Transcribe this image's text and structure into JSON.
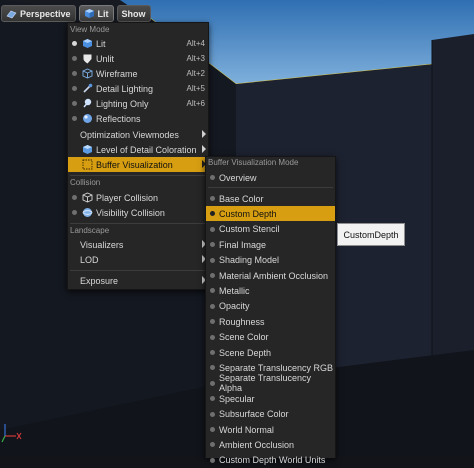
{
  "toolbar": {
    "perspective_label": "Perspective",
    "lit_label": "Lit",
    "show_label": "Show"
  },
  "main_menu": {
    "section_view_mode": "View Mode",
    "items": [
      {
        "label": "Lit",
        "shortcut": "Alt+4",
        "icon": "lit-cube-icon",
        "selected": true
      },
      {
        "label": "Unlit",
        "shortcut": "Alt+3",
        "icon": "unlit-shield-icon",
        "selected": false
      },
      {
        "label": "Wireframe",
        "shortcut": "Alt+2",
        "icon": "wireframe-cube-icon",
        "selected": false
      },
      {
        "label": "Detail Lighting",
        "shortcut": "Alt+5",
        "icon": "detail-lighting-icon",
        "selected": false
      },
      {
        "label": "Lighting Only",
        "shortcut": "Alt+6",
        "icon": "lighting-only-icon",
        "selected": false
      },
      {
        "label": "Reflections",
        "shortcut": "",
        "icon": "reflections-sphere-icon",
        "selected": false
      }
    ],
    "optimization_viewmodes": "Optimization Viewmodes",
    "lod_coloration": "Level of Detail Coloration",
    "buffer_visualization": "Buffer Visualization",
    "section_collision": "Collision",
    "player_collision": "Player Collision",
    "visibility_collision": "Visibility Collision",
    "section_landscape": "Landscape",
    "visualizers": "Visualizers",
    "lod": "LOD",
    "exposure": "Exposure"
  },
  "sub_menu": {
    "header": "Buffer Visualization Mode",
    "overview": "Overview",
    "items": [
      "Base Color",
      "Custom Depth",
      "Custom Stencil",
      "Final Image",
      "Shading Model",
      "Material Ambient Occlusion",
      "Metallic",
      "Opacity",
      "Roughness",
      "Scene Color",
      "Scene Depth",
      "Separate Translucency RGB",
      "Separate Translucency Alpha",
      "Specular",
      "Subsurface Color",
      "World Normal",
      "Ambient Occlusion",
      "Custom Depth World Units"
    ],
    "selected_index": 1
  },
  "tooltip": "CustomDepth",
  "colors": {
    "highlight": "#d79e11",
    "menu_bg": "#262626",
    "sky": "#4a7fb8"
  }
}
